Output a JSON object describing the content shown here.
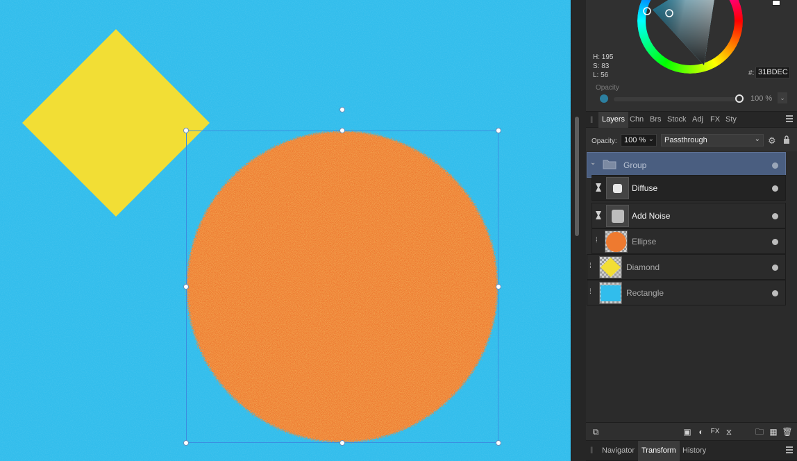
{
  "color_panel": {
    "h_label": "H: 195",
    "s_label": "S: 83",
    "l_label": "L: 56",
    "hex_prefix": "#:",
    "hex_value": "31BDEC",
    "opacity_label": "Opacity",
    "opacity_value": "100 %",
    "current_color": "#31BDEC",
    "opacity_fraction": 1.0
  },
  "studio_tabs": {
    "items": [
      "Layers",
      "Chn",
      "Brs",
      "Stock",
      "Adj",
      "FX",
      "Sty"
    ],
    "active": "Layers"
  },
  "layer_options": {
    "opacity_label": "Opacity:",
    "opacity_value": "100 %",
    "blend_mode": "Passthrough"
  },
  "layers": [
    {
      "name": "Group",
      "kind": "group",
      "selected": true
    },
    {
      "name": "Diffuse",
      "kind": "live-filter"
    },
    {
      "name": "Add Noise",
      "kind": "live-filter"
    },
    {
      "name": "Ellipse",
      "kind": "shape",
      "color": "#EE7A30"
    },
    {
      "name": "Diamond",
      "kind": "shape",
      "color": "#F2DE35"
    },
    {
      "name": "Rectangle",
      "kind": "shape",
      "color": "#31BDEC"
    }
  ],
  "bottom_tabs": {
    "items": [
      "Navigator",
      "Transform",
      "History"
    ],
    "active": "Transform"
  },
  "canvas": {
    "background_color": "#31BDEC",
    "diamond_color": "#F2DE35",
    "ellipse_color": "#EE7A30",
    "selection_color": "#3b8ee0"
  }
}
